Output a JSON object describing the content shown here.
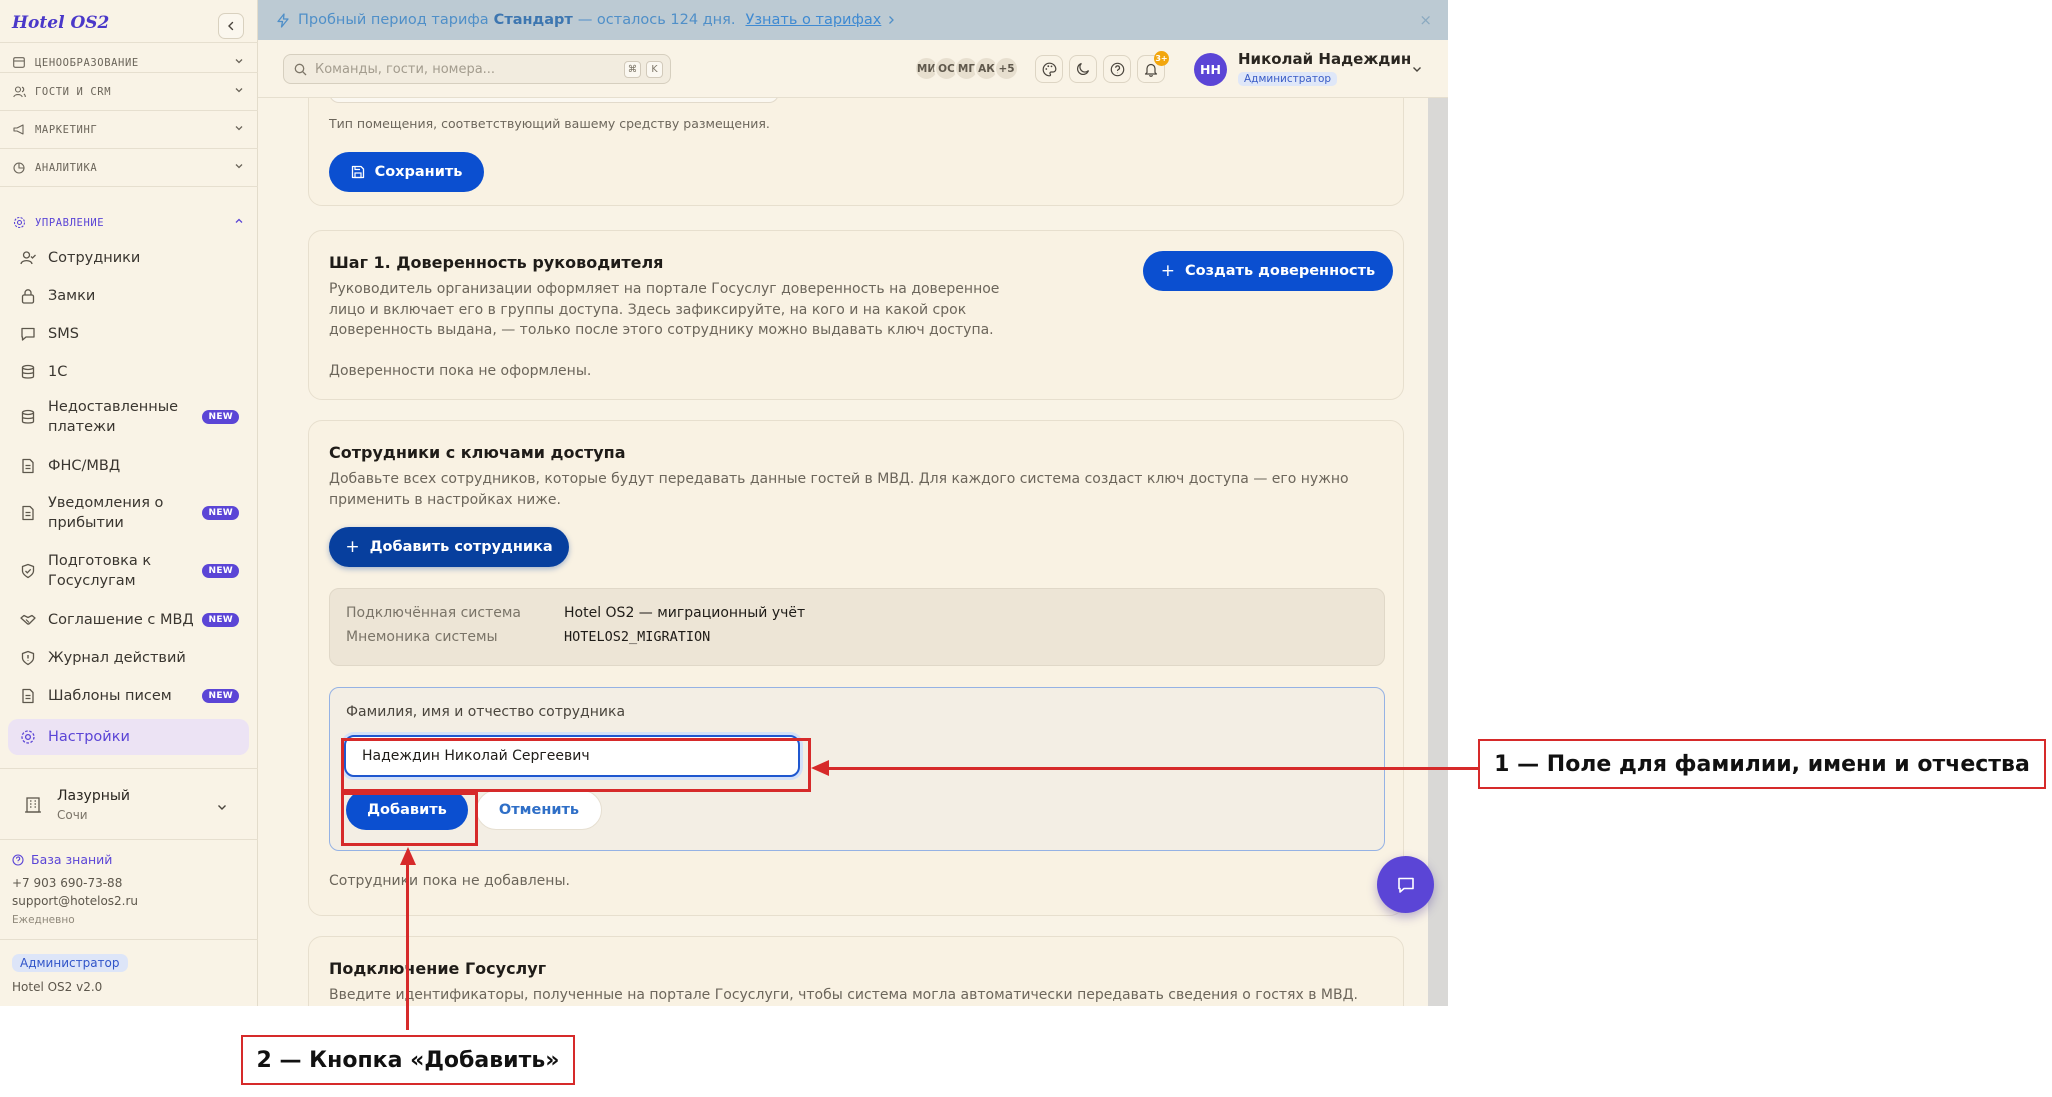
{
  "app": {
    "logo": "Hotel OS2"
  },
  "sidebar": {
    "sections": [
      {
        "label": "Ценообразование",
        "icon": "wallet-icon"
      },
      {
        "label": "Гости и CRM",
        "icon": "users-icon"
      },
      {
        "label": "Маркетинг",
        "icon": "megaphone-icon"
      },
      {
        "label": "Аналитика",
        "icon": "pie-chart-icon"
      },
      {
        "label": "Управление",
        "icon": "gear-icon",
        "expanded": true
      }
    ],
    "items": [
      {
        "label": "Сотрудники",
        "icon": "user-check-icon"
      },
      {
        "label": "Замки",
        "icon": "lock-icon"
      },
      {
        "label": "SMS",
        "icon": "message-icon"
      },
      {
        "label": "1С",
        "icon": "database-icon"
      },
      {
        "label": "Недоставленные платежи",
        "icon": "database-icon",
        "badge": "NEW"
      },
      {
        "label": "ФНС/МВД",
        "icon": "document-icon"
      },
      {
        "label": "Уведомления о прибытии",
        "icon": "document-icon",
        "badge": "NEW"
      },
      {
        "label": "Подготовка к Госуслугам",
        "icon": "shield-check-icon",
        "badge": "NEW"
      },
      {
        "label": "Соглашение с МВД",
        "icon": "handshake-icon",
        "badge": "NEW"
      },
      {
        "label": "Журнал действий",
        "icon": "shield-alert-icon"
      },
      {
        "label": "Шаблоны писем",
        "icon": "document-icon",
        "badge": "NEW"
      },
      {
        "label": "Настройки",
        "icon": "gear-icon",
        "active": true
      }
    ],
    "hotel": {
      "name": "Лазурный",
      "city": "Сочи"
    },
    "knowledge_base": "База знаний",
    "phone": "+7 903 690-73-88",
    "email": "support@hotelos2.ru",
    "schedule": "Ежедневно",
    "role": "Администратор",
    "version": "Hotel OS2 v2.0"
  },
  "trial_bar": {
    "text_before": "Пробный период тарифа",
    "plan": "Стандарт",
    "text_after": "— осталось 124 дня.",
    "link": "Узнать о тарифах",
    "close": "×"
  },
  "topbar": {
    "search_placeholder": "Команды, гости, номера...",
    "kbd1": "⌘",
    "kbd2": "K",
    "team_avatars": [
      "МИ",
      "ОС",
      "МГ",
      "АК"
    ],
    "team_more": "+5",
    "notifications_count": "3+",
    "user": {
      "initials": "НН",
      "name": "Николай Надеждин",
      "role": "Администратор"
    }
  },
  "main": {
    "room_type_hint": "Тип помещения, соответствующий вашему средству размещения.",
    "save_label": "Сохранить",
    "step1": {
      "title": "Шаг 1. Доверенность руководителя",
      "description_lines": [
        "Руководитель организации оформляет на портале Госуслуг доверенность на доверенное",
        "лицо и включает его в группы доступа. Здесь зафиксируйте, на кого и на какой срок",
        "доверенность выдана, — только после этого сотруднику можно выдавать ключ доступа."
      ],
      "empty": "Доверенности пока не оформлены.",
      "create_button": "Создать доверенность"
    },
    "employees": {
      "title": "Сотрудники с ключами доступа",
      "description_lines": [
        "Добавьте всех сотрудников, которые будут передавать данные гостей в МВД. Для каждого система создаст ключ доступа — его нужно",
        "применить в настройках ниже."
      ],
      "add_button": "Добавить сотрудника",
      "system_label": "Подключённая система",
      "system_value": "Hotel OS2 — миграционный учёт",
      "mnemonic_label": "Мнемоника системы",
      "mnemonic_value": "HOTELOS2_MIGRATION",
      "fio_label": "Фамилия, имя и отчество сотрудника",
      "fio_value": "Надеждин Николай Сергеевич",
      "add": "Добавить",
      "cancel": "Отменить",
      "empty": "Сотрудники пока не добавлены."
    },
    "gosuslugi": {
      "title": "Подключение Госуслуг",
      "description": "Введите идентификаторы, полученные на портале Госуслуги, чтобы система могла автоматически передавать сведения о гостях в МВД."
    }
  },
  "annotations": {
    "label1": "1 — Поле для фамилии, имени и отчества",
    "label2": "2 — Кнопка «Добавить»"
  },
  "colors": {
    "accent": "#5b45d6",
    "primary_button": "#0b4fd0",
    "background": "#f9f3e6",
    "annotation": "#d62a2a"
  }
}
